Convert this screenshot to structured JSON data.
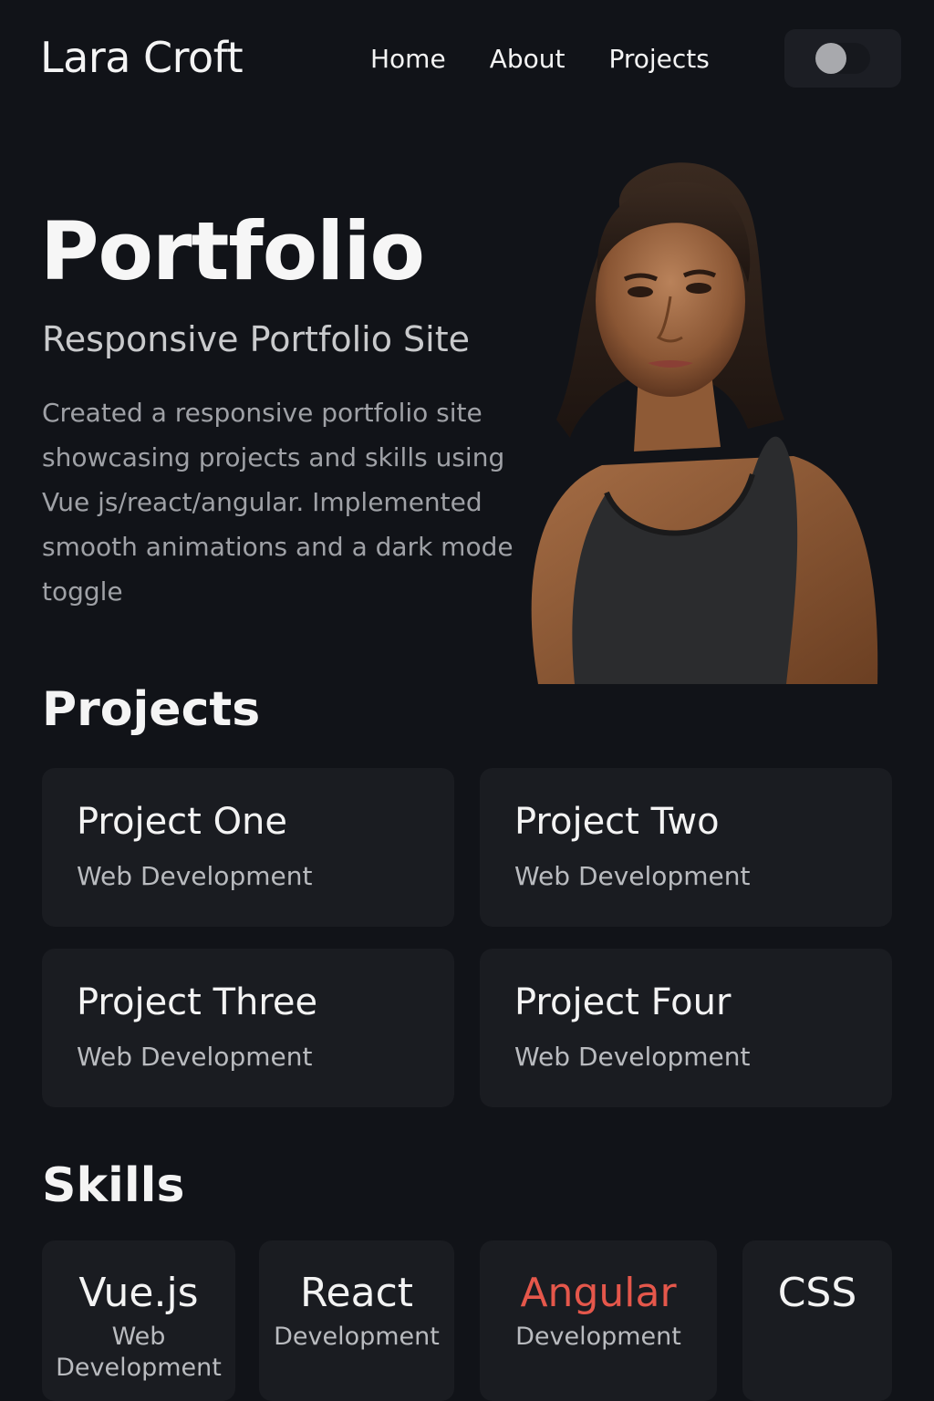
{
  "header": {
    "brand": "Lara Croft",
    "nav": {
      "home": "Home",
      "about": "About",
      "projects": "Projects"
    },
    "theme_toggle_icon": "toggle-switch-icon"
  },
  "hero": {
    "title": "Portfolio",
    "subtitle": "Responsive Portfolio Site",
    "description": "Created a responsive portfolio site showcasing projects and skills using Vue js/react/angular. Implemented smooth animations and a dark mode toggle",
    "portrait_alt": "portrait photo"
  },
  "projects": {
    "heading": "Projects",
    "items": [
      {
        "title": "Project One",
        "category": "Web Development"
      },
      {
        "title": "Project Two",
        "category": "Web Development"
      },
      {
        "title": "Project Three",
        "category": "Web Development"
      },
      {
        "title": "Project Four",
        "category": "Web Development"
      }
    ]
  },
  "skills": {
    "heading": "Skills",
    "items": [
      {
        "name": "Vue.js",
        "desc": "Web Development"
      },
      {
        "name": "React",
        "desc": "Development"
      },
      {
        "name": "Angular",
        "desc": "Development"
      },
      {
        "name": "CSS",
        "desc": ""
      }
    ]
  },
  "colors": {
    "background": "#111318",
    "card": "#1a1c21",
    "accent": "#e5574b"
  }
}
